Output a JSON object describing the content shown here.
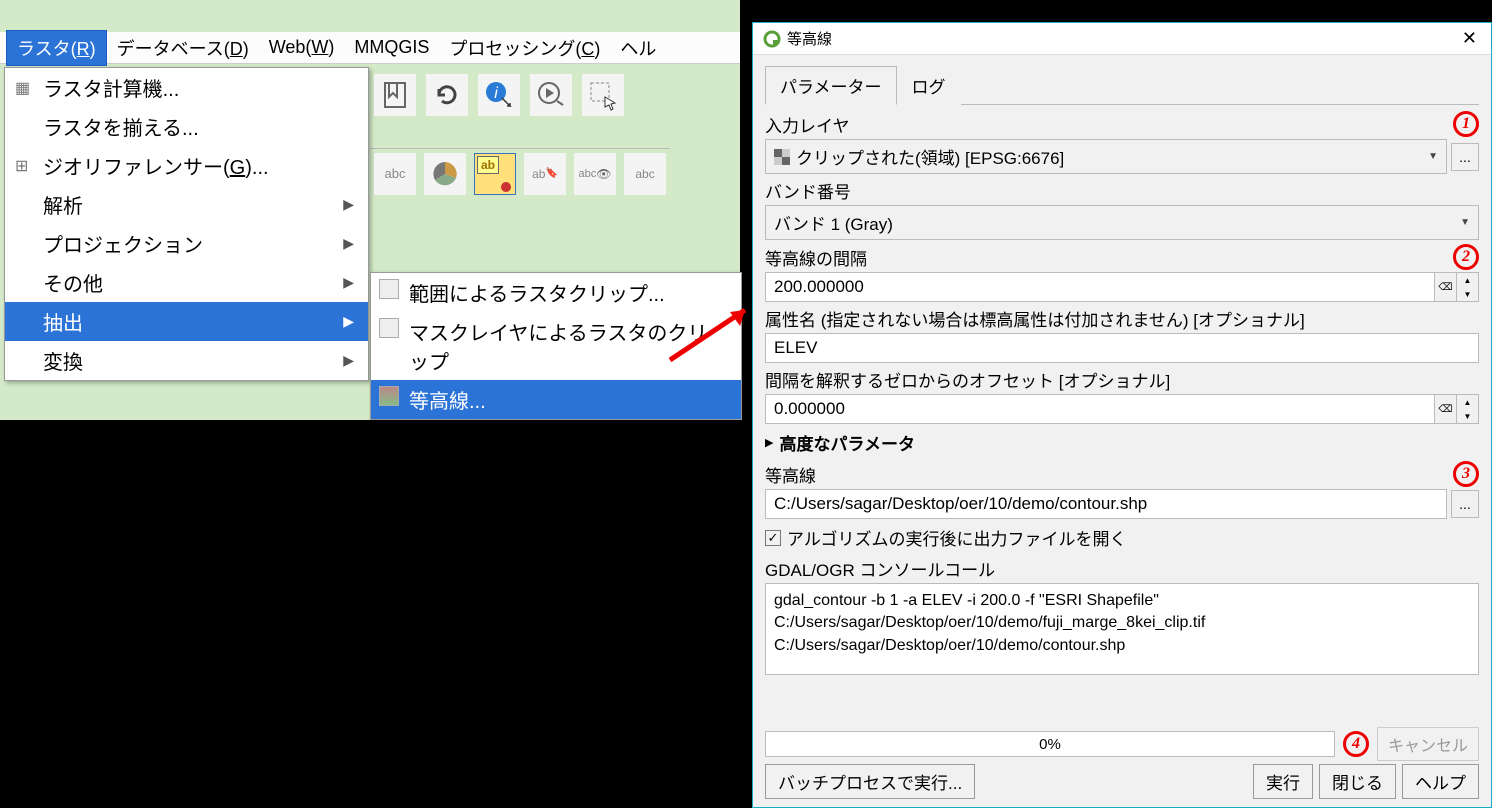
{
  "menubar": {
    "raster": "ラスタ(R)",
    "database": "データベース(D)",
    "web": "Web(W)",
    "mmqgis": "MMQGIS",
    "processing": "プロセッシング(C)",
    "help": "ヘル"
  },
  "dropdown1": {
    "calc": "ラスタ計算機...",
    "align": "ラスタを揃える...",
    "georef": "ジオリファレンサー(G)...",
    "analysis": "解析",
    "projection": "プロジェクション",
    "other": "その他",
    "extract": "抽出",
    "convert": "変換"
  },
  "dropdown2": {
    "clip_extent": "範囲によるラスタクリップ...",
    "clip_mask": "マスクレイヤによるラスタのクリップ",
    "contour": "等高線..."
  },
  "dialog": {
    "title": "等高線",
    "tabs": {
      "params": "パラメーター",
      "log": "ログ"
    },
    "input_layer_label": "入力レイヤ",
    "input_layer_value": "クリップされた(領域) [EPSG:6676]",
    "band_label": "バンド番号",
    "band_value": "バンド 1 (Gray)",
    "interval_label": "等高線の間隔",
    "interval_value": "200.000000",
    "attr_label": "属性名 (指定されない場合は標高属性は付加されません) [オプショナル]",
    "attr_value": "ELEV",
    "offset_label": "間隔を解釈するゼロからのオフセット [オプショナル]",
    "offset_value": "0.000000",
    "advanced": "高度なパラメータ",
    "output_label": "等高線",
    "output_value": "C:/Users/sagar/Desktop/oer/10/demo/contour.shp",
    "open_after": "アルゴリズムの実行後に出力ファイルを開く",
    "console_label": "GDAL/OGR コンソールコール",
    "console_text": "gdal_contour -b 1 -a ELEV -i 200.0 -f \"ESRI Shapefile\" C:/Users/sagar/Desktop/oer/10/demo/fuji_marge_8kei_clip.tif C:/Users/sagar/Desktop/oer/10/demo/contour.shp",
    "progress": "0%",
    "cancel": "キャンセル",
    "batch": "バッチプロセスで実行...",
    "run": "実行",
    "close": "閉じる",
    "help": "ヘルプ"
  },
  "annotations": {
    "n1": "1",
    "n2": "2",
    "n3": "3",
    "n4": "4"
  }
}
